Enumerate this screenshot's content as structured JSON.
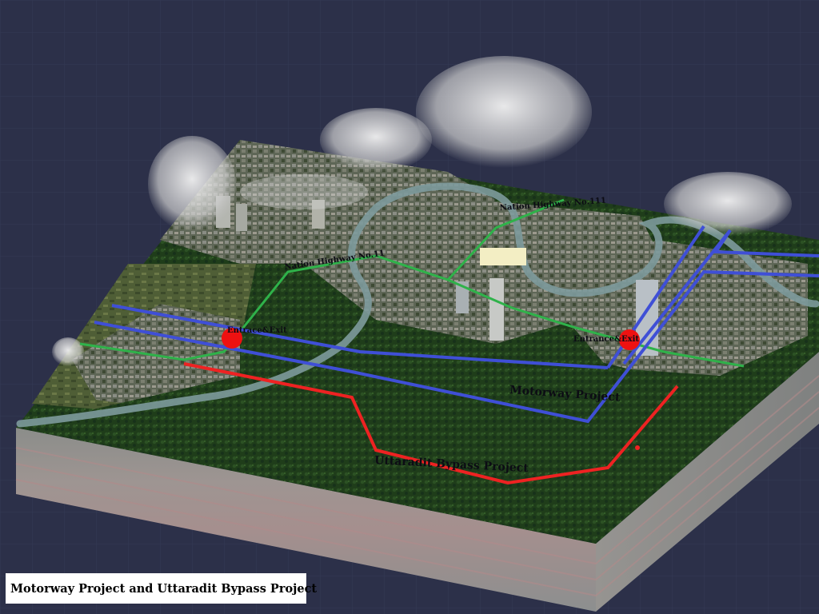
{
  "caption": "Motorway Project and Uttaradit Bypass Project",
  "labels": {
    "highway_11": "Nation Highway No.11",
    "highway_111": "Nation Highway No.111",
    "entrance_west": "Entrace&Exit",
    "entrance_east": "Entrance&Exit",
    "motorway": "Motorway Project",
    "bypass": "Uttaradit Bypass Project"
  },
  "colors": {
    "ocean": "#2c3049",
    "forest": "#1f3d1a",
    "city": "#6f7464",
    "river": "#7d9a9c",
    "motorway_route": "#3f4fd6",
    "bypass_route": "#ee2222",
    "highway_route": "#2fb24a",
    "interchange_marker": "#ee1111",
    "cloud": "#e8e8e8"
  },
  "legend_semantics": {
    "blue_lines": "motorway",
    "red_line": "bypass",
    "green_lines": "national highway"
  }
}
